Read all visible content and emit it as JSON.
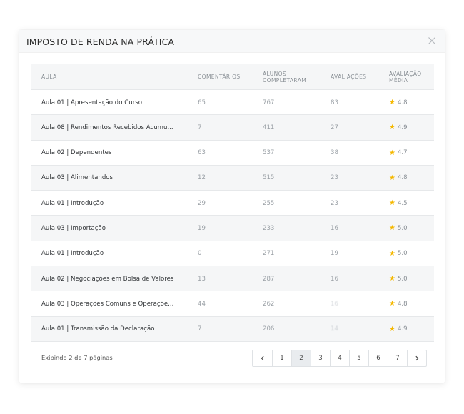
{
  "modal": {
    "title": "IMPOSTO DE RENDA NA PRÁTICA",
    "close_icon": "close-icon"
  },
  "table": {
    "headers": [
      "AULA",
      "COMENTÁRIOS",
      "ALUNOS COMPLETARAM",
      "AVALIAÇÕES",
      "AVALIAÇÃO MÉDIA"
    ],
    "rows": [
      {
        "aula": "Aula 01 | Apresentação do Curso",
        "comentarios": "65",
        "alunos": "767",
        "avaliacoes": "83",
        "media": "4.8"
      },
      {
        "aula": "Aula 08 | Rendimentos Recebidos Acumu...",
        "comentarios": "7",
        "alunos": "411",
        "avaliacoes": "27",
        "media": "4.9"
      },
      {
        "aula": "Aula 02 | Dependentes",
        "comentarios": "63",
        "alunos": "537",
        "avaliacoes": "38",
        "media": "4.7"
      },
      {
        "aula": "Aula 03 | Alimentandos",
        "comentarios": "12",
        "alunos": "515",
        "avaliacoes": "23",
        "media": "4.8"
      },
      {
        "aula": "Aula 01 | Introdução",
        "comentarios": "29",
        "alunos": "255",
        "avaliacoes": "23",
        "media": "4.5"
      },
      {
        "aula": "Aula 03 | Importação",
        "comentarios": "19",
        "alunos": "233",
        "avaliacoes": "16",
        "media": "5.0"
      },
      {
        "aula": "Aula 01 | Introdução",
        "comentarios": "0",
        "alunos": "271",
        "avaliacoes": "19",
        "media": "5.0"
      },
      {
        "aula": "Aula 02 | Negociações em Bolsa de Valores",
        "comentarios": "13",
        "alunos": "287",
        "avaliacoes": "16",
        "media": "5.0"
      },
      {
        "aula": "Aula 03 | Operações Comuns e Operaçõe...",
        "comentarios": "44",
        "alunos": "262",
        "avaliacoes": "16",
        "media": "4.8"
      },
      {
        "aula": "Aula 01 | Transmissão da Declaração",
        "comentarios": "7",
        "alunos": "206",
        "avaliacoes": "14",
        "media": "4.9"
      }
    ],
    "star_color": "#f5b800"
  },
  "footer": {
    "status": "Exibindo 2 de 7 páginas"
  },
  "pagination": {
    "prev": "‹",
    "pages": [
      "1",
      "2",
      "3",
      "4",
      "5",
      "6",
      "7"
    ],
    "current": "2",
    "next": "›"
  }
}
